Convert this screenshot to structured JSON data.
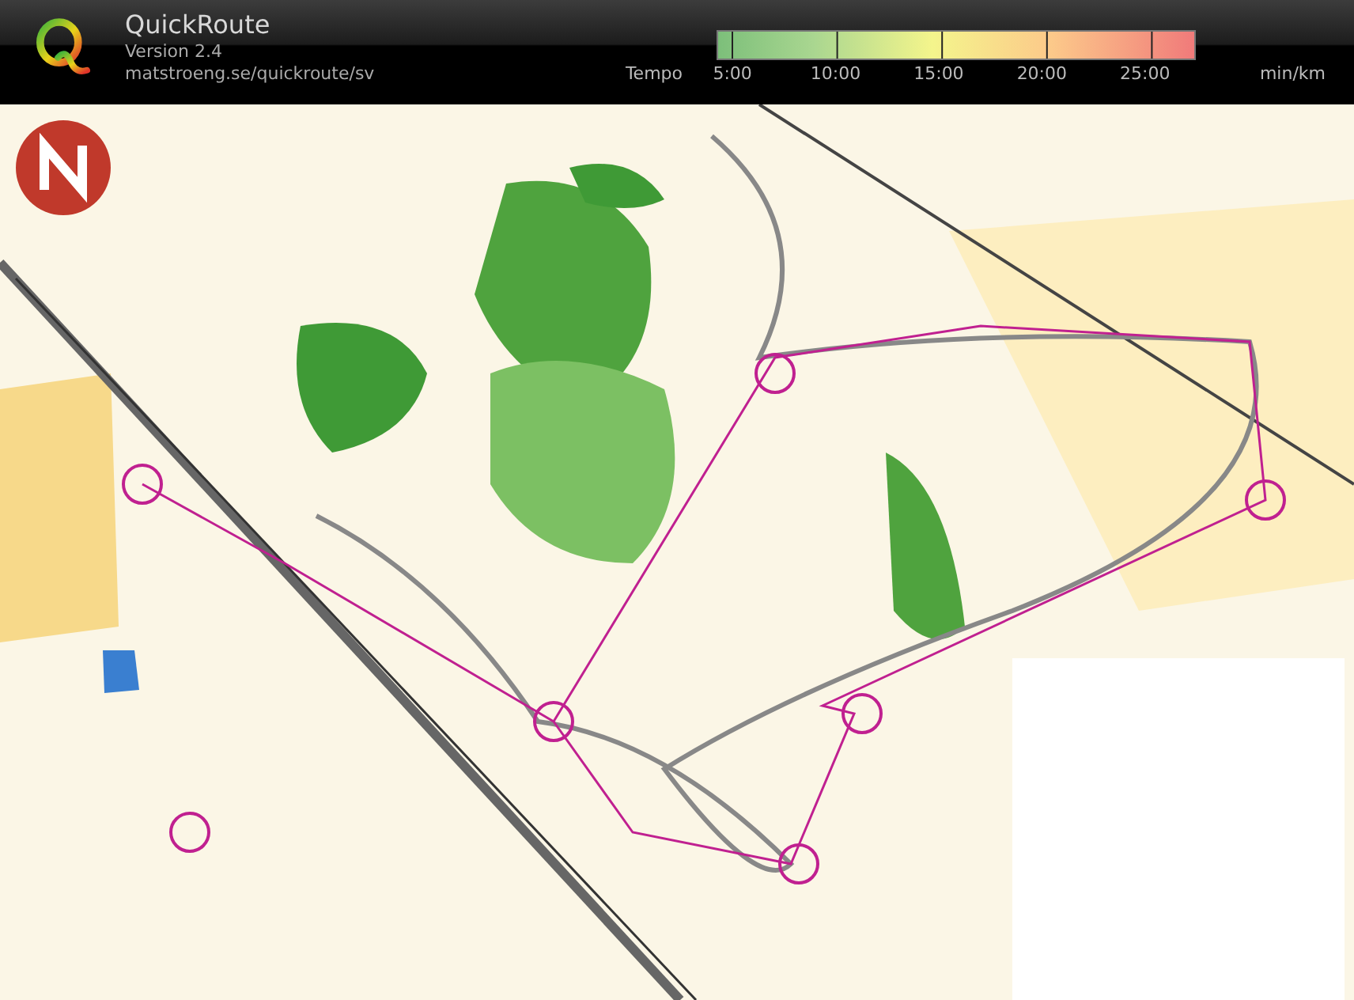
{
  "app": {
    "title": "QuickRoute",
    "version": "Version 2.4",
    "url": "matstroeng.se/quickroute/sv"
  },
  "pace_legend": {
    "label": "Tempo",
    "ticks": [
      "5:00",
      "10:00",
      "15:00",
      "20:00",
      "25:00"
    ],
    "unit": "min/km"
  }
}
